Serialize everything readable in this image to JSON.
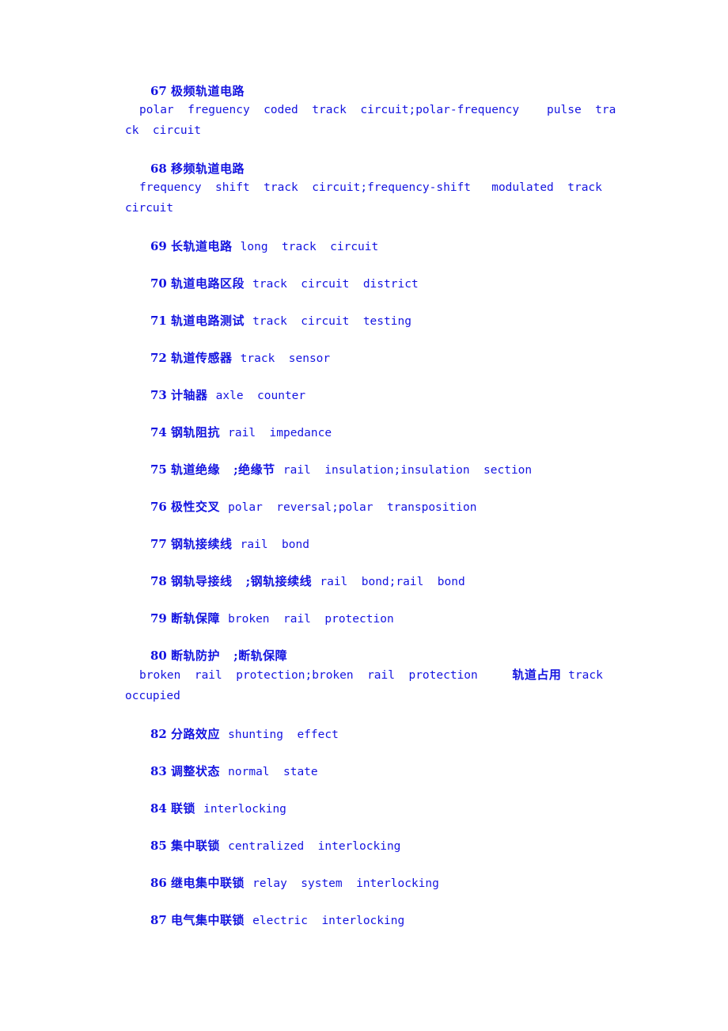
{
  "document": {
    "type": "bilingual-glossary",
    "subject": "railway signalling / track circuit terminology",
    "text_color": "#1414e0",
    "background_color": "#ffffff",
    "number_range": "67-87"
  },
  "entries": [
    {
      "number": "67",
      "zh": "极频轨道电路",
      "en": "polar  freguency  coded  track  circuit;polar-frequency    pulse  track  circuit",
      "layout": "block"
    },
    {
      "number": "68",
      "zh": "移频轨道电路",
      "en": "frequency  shift  track  circuit;frequency-shift   modulated  track  circuit",
      "layout": "block"
    },
    {
      "number": "69",
      "zh": "长轨道电路",
      "en": "long  track  circuit",
      "layout": "inline"
    },
    {
      "number": "70",
      "zh": "轨道电路区段",
      "en": "track  circuit  district",
      "layout": "inline"
    },
    {
      "number": "71",
      "zh": "轨道电路测试",
      "en": "track  circuit  testing",
      "layout": "inline"
    },
    {
      "number": "72",
      "zh": "轨道传感器",
      "en": "track  sensor",
      "layout": "inline"
    },
    {
      "number": "73",
      "zh": "计轴器",
      "en": "axle  counter",
      "layout": "inline"
    },
    {
      "number": "74",
      "zh": "钢轨阻抗",
      "en": "rail  impedance",
      "layout": "inline"
    },
    {
      "number": "75",
      "zh": "轨道绝缘   ;绝缘节",
      "en": "rail  insulation;insulation  section",
      "layout": "inline"
    },
    {
      "number": "76",
      "zh": "极性交叉",
      "en": "polar  reversal;polar  transposition",
      "layout": "inline"
    },
    {
      "number": "77",
      "zh": "钢轨接续线",
      "en": "rail  bond",
      "layout": "inline"
    },
    {
      "number": "78",
      "zh": "钢轨导接线   ;钢轨接续线",
      "en": "rail  bond;rail  bond",
      "layout": "inline"
    },
    {
      "number": "79",
      "zh": "断轨保障",
      "en": "broken  rail  protection",
      "layout": "inline"
    },
    {
      "number": "80",
      "zh": "断轨防护   ;断轨保障",
      "en": "broken  rail  protection;broken  rail  protection",
      "trailing_zh": "轨道占用",
      "trailing_en": "track  occupied",
      "layout": "block-trailing"
    },
    {
      "number": "82",
      "zh": "分路效应",
      "en": "shunting  effect",
      "layout": "inline"
    },
    {
      "number": "83",
      "zh": "调整状态",
      "en": "normal  state",
      "layout": "inline"
    },
    {
      "number": "84",
      "zh": "联锁",
      "en": "interlocking",
      "layout": "inline"
    },
    {
      "number": "85",
      "zh": "集中联锁",
      "en": "centralized  interlocking",
      "layout": "inline"
    },
    {
      "number": "86",
      "zh": "继电集中联锁",
      "en": "relay  system  interlocking",
      "layout": "inline"
    },
    {
      "number": "87",
      "zh": "电气集中联锁",
      "en": "electric  interlocking",
      "layout": "inline"
    }
  ]
}
